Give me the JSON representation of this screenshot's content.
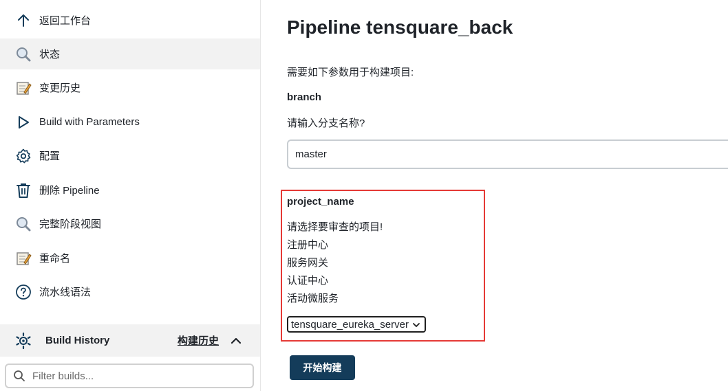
{
  "sidebar": {
    "items": [
      {
        "label": "返回工作台",
        "icon": "arrow-up-icon"
      },
      {
        "label": "状态",
        "icon": "magnifier-icon"
      },
      {
        "label": "变更历史",
        "icon": "notepad-icon"
      },
      {
        "label": "Build with Parameters",
        "icon": "play-icon"
      },
      {
        "label": "配置",
        "icon": "gear-icon"
      },
      {
        "label": "删除 Pipeline",
        "icon": "trash-icon"
      },
      {
        "label": "完整阶段视图",
        "icon": "magnifier-icon"
      },
      {
        "label": "重命名",
        "icon": "notepad-icon"
      },
      {
        "label": "流水线语法",
        "icon": "help-circle-icon"
      }
    ],
    "active_index": 1
  },
  "build_history": {
    "title": "Build History",
    "link": "构建历史",
    "filter_placeholder": "Filter builds..."
  },
  "main": {
    "title": "Pipeline tensquare_back",
    "description": "需要如下参数用于构建项目:",
    "params": {
      "branch": {
        "name": "branch",
        "description": "请输入分支名称?",
        "value": "master"
      },
      "project_name": {
        "name": "project_name",
        "description_lines": [
          "请选择要审查的项目!",
          "注册中心",
          "服务网关",
          "认证中心",
          "活动微服务"
        ],
        "selected": "tensquare_eureka_server"
      }
    },
    "build_button": "开始构建"
  },
  "colors": {
    "accent": "#143c5a",
    "highlight": "#e53935",
    "active_bg": "#f2f2f2"
  }
}
